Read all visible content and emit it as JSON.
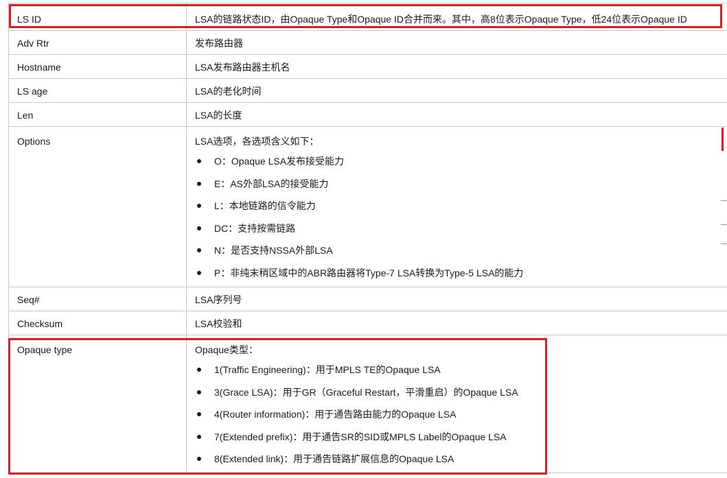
{
  "rows": [
    {
      "field": "LS ID",
      "desc": "LSA的链路状态ID，由Opaque Type和Opaque ID合并而来。其中，高8位表示Opaque Type，低24位表示Opaque ID"
    },
    {
      "field": "Adv Rtr",
      "desc": "发布路由器"
    },
    {
      "field": "Hostname",
      "desc": "LSA发布路由器主机名"
    },
    {
      "field": "LS age",
      "desc": "LSA的老化时间"
    },
    {
      "field": "Len",
      "desc": "LSA的长度"
    },
    {
      "field": "Options",
      "desc": "LSA选项，各选项含义如下：",
      "items": [
        "O：Opaque LSA发布接受能力",
        "E：AS外部LSA的接受能力",
        "L：本地链路的信令能力",
        "DC：支持按需链路",
        "N：是否支持NSSA外部LSA",
        "P：非纯末稍区域中的ABR路由器将Type-7 LSA转换为Type-5 LSA的能力"
      ]
    },
    {
      "field": "Seq#",
      "desc": "LSA序列号"
    },
    {
      "field": "Checksum",
      "desc": "LSA校验和"
    },
    {
      "field": "Opaque type",
      "desc": "Opaque类型：",
      "items": [
        "1(Traffic Engineering)：用于MPLS TE的Opaque LSA",
        "3(Grace LSA)：用于GR（Graceful Restart，平滑重启）的Opaque LSA",
        "4(Router information)：用于通告路由能力的Opaque LSA",
        "7(Extended prefix)：用于通告SR的SID或MPLS Label的Opaque LSA",
        "8(Extended link)：用于通告链路扩展信息的Opaque LSA"
      ]
    }
  ],
  "colors": {
    "highlight": "#e11b22",
    "border": "#c9c9c9",
    "text": "#1a1a1a"
  }
}
